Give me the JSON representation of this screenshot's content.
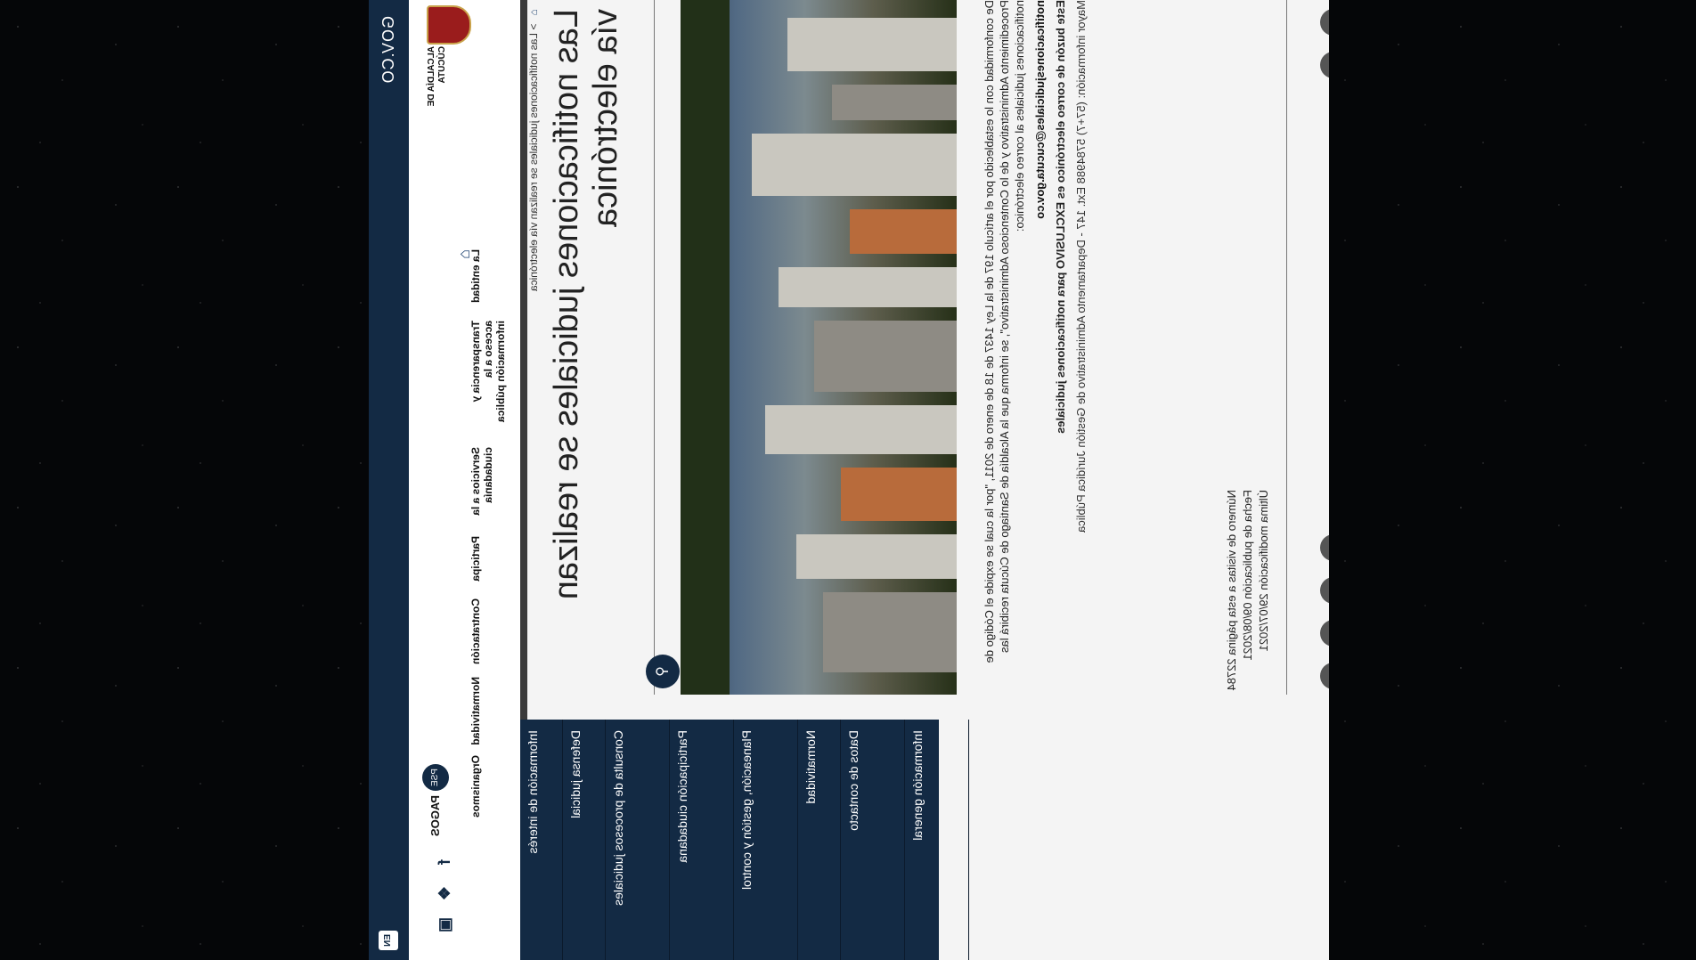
{
  "topbar": {
    "gov": "GOV.CO",
    "lang": "EN"
  },
  "header": {
    "logo_text": "ALCALDÍA DE CÚCUTA",
    "nav": [
      {
        "label": "La entidad"
      },
      {
        "label": "Transparencia y acceso a la información pública"
      },
      {
        "label": "Servicios a la ciudadanía"
      },
      {
        "label": "Participa"
      },
      {
        "label": "Contratación"
      },
      {
        "label": "Normatividad"
      },
      {
        "label": "Organismos"
      }
    ],
    "pse_label": "PAGOS",
    "pse_badge": "PSE"
  },
  "breadcrumb": {
    "separator": ">",
    "current": "Las notificaciones judiciales se realizan vía electrónica"
  },
  "title": "Las notificaciones judiciales se realizan vía electrónica",
  "sidebar": [
    {
      "label": "Información de interés"
    },
    {
      "label": "Defensa judicial"
    },
    {
      "label": "Consulta de procesos judiciales"
    },
    {
      "label": "Participación ciudadana"
    },
    {
      "label": "Planeación, gestión y control"
    },
    {
      "label": "Normatividad"
    },
    {
      "label": "Datos de contacto"
    },
    {
      "label": "Información general"
    }
  ],
  "article": {
    "p1": "De conformidad con lo establecido por el artículo 197 de la Ley 1437 de 18 de enero de 2011, \"por la cual se expide el Código de Procedimiento Administrativo y de lo Contencioso Administrativo\", se informa que la Alcaldía de Santiago de Cúcuta recibirá las notificaciones judiciales al correo electrónico:",
    "email": "notificacionesjudiciales@cucuta.gov.co",
    "p2": "Este buzón de correo electrónico es EXCLUSIVO para notificaciones judiciales",
    "p3": "Mayor información: (57+7) 5784988 Ext. 147 - Departamento Administrativo de Gestión Jurídica Pública"
  },
  "meta": {
    "visits": "Número de visitas a esta página 22784",
    "published": "Fecha de publicación 09/08/2021",
    "modified": "Última modificación 29/07/2021"
  }
}
